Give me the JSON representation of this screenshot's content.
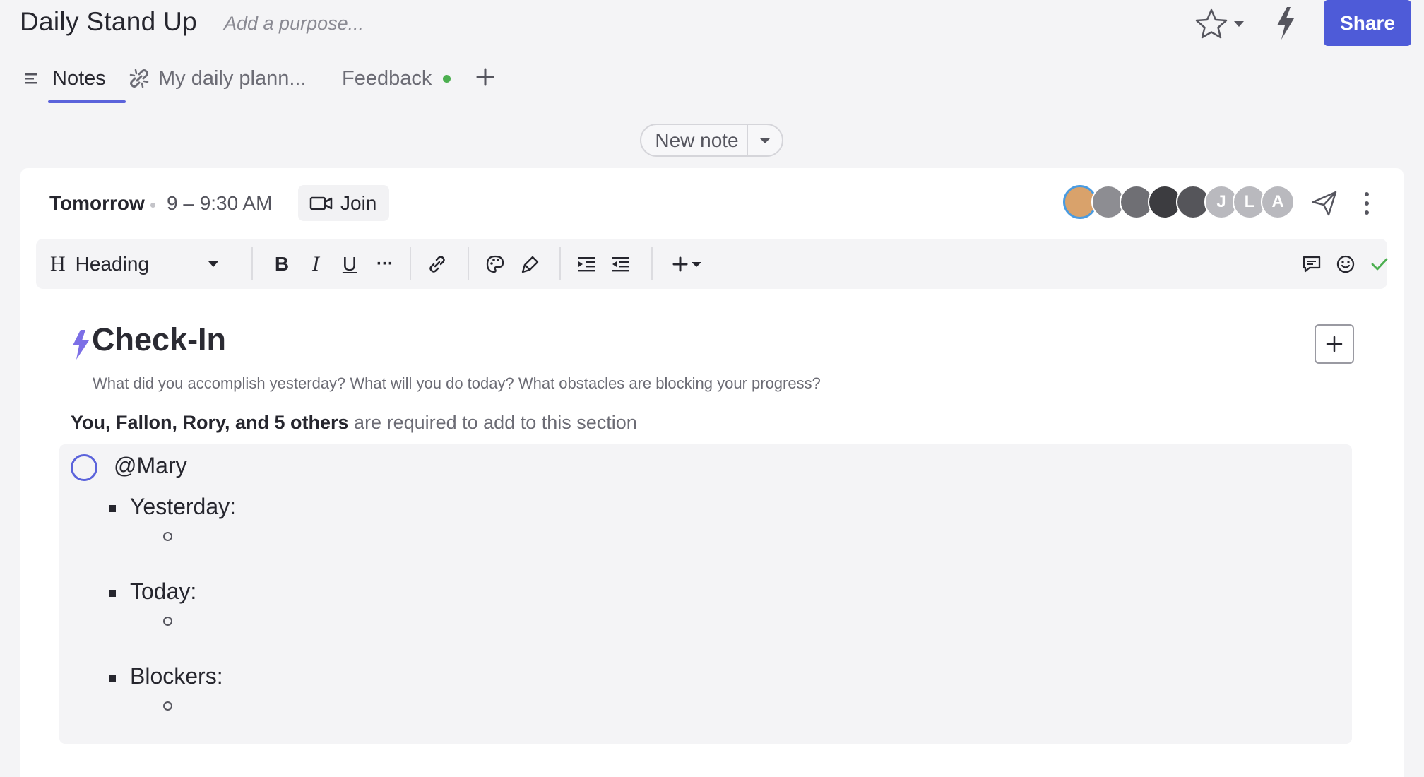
{
  "header": {
    "title": "Daily Stand Up",
    "purpose_placeholder": "Add a purpose...",
    "share_label": "Share",
    "icons": [
      "star-icon",
      "chevron-down-icon",
      "bolt-icon"
    ]
  },
  "tabs": [
    {
      "label": "Notes",
      "icon": "notes-list-icon",
      "active": true
    },
    {
      "label": "My daily plann...",
      "icon": "linked-icon",
      "active": false
    },
    {
      "label": "Feedback",
      "icon": "",
      "active": false,
      "status_dot": "#4caf50"
    }
  ],
  "new_note": {
    "label": "New note"
  },
  "meeting": {
    "when": "Tomorrow",
    "time": "9 – 9:30 AM",
    "join_label": "Join",
    "attendees": [
      {
        "initial": "",
        "color": "#d9a26b"
      },
      {
        "initial": "",
        "color": "#8d8d92"
      },
      {
        "initial": "",
        "color": "#6f6f74"
      },
      {
        "initial": "",
        "color": "#3c3c40"
      },
      {
        "initial": "",
        "color": "#55555a"
      },
      {
        "initial": "J",
        "color": "#b9b9be"
      },
      {
        "initial": "L",
        "color": "#b9b9be"
      },
      {
        "initial": "A",
        "color": "#b9b9be"
      }
    ]
  },
  "toolbar": {
    "heading_label": "Heading",
    "bold": "B",
    "italic": "I",
    "underline": "U",
    "more": "···"
  },
  "section": {
    "title": "Check-In",
    "description": "What did you accomplish yesterday? What will you do today? What obstacles are blocking your progress?",
    "required_names": "You, Fallon, Rory, and 5 others",
    "required_suffix": " are required to add to this section",
    "entry": {
      "user": "@Mary",
      "items": [
        "Yesterday:",
        "Today:",
        "Blockers:"
      ]
    }
  },
  "colors": {
    "accent": "#5b63db",
    "share": "#4e5bd8",
    "bolt": "#7c6fe6",
    "check": "#4caf50"
  }
}
